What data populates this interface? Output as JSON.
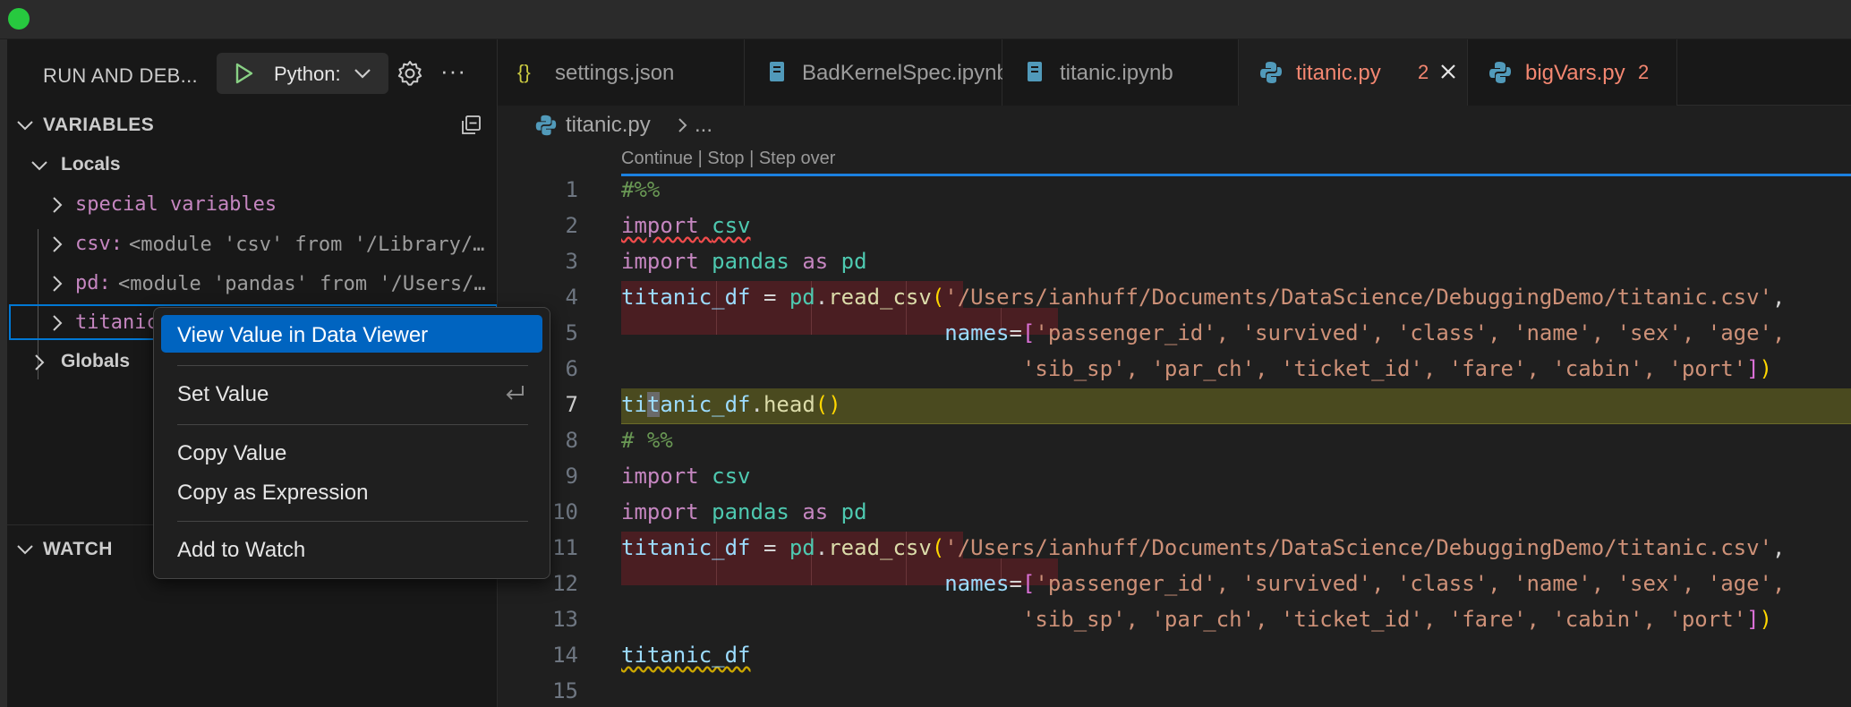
{
  "debug_toolbar": {
    "title": "RUN AND DEB...",
    "launch_config": "Python:"
  },
  "variables": {
    "header": "VARIABLES",
    "locals_label": "Locals",
    "items": [
      {
        "name": "special variables",
        "value": ""
      },
      {
        "name": "csv:",
        "value": "<module 'csv' from '/Library/…"
      },
      {
        "name": "pd:",
        "value": "<module 'pandas' from '/Users/…"
      },
      {
        "name": "titanic",
        "value": ""
      }
    ],
    "globals_label": "Globals"
  },
  "watch": {
    "header": "WATCH"
  },
  "tabs": [
    {
      "label": "settings.json",
      "icon": "json-icon",
      "badge": "",
      "active": false
    },
    {
      "label": "BadKernelSpec.ipynb",
      "icon": "notebook-icon",
      "badge": "",
      "active": false
    },
    {
      "label": "titanic.ipynb",
      "icon": "notebook-icon",
      "badge": "",
      "active": false
    },
    {
      "label": "titanic.py",
      "icon": "python-icon",
      "badge": "2",
      "active": true
    },
    {
      "label": "bigVars.py",
      "icon": "python-icon",
      "badge": "2",
      "active": false
    }
  ],
  "breadcrumb": {
    "file": "titanic.py",
    "more": "..."
  },
  "editor": {
    "codelens": "Continue | Stop | Step over",
    "line_numbers": [
      "1",
      "2",
      "3",
      "4",
      "5",
      "6",
      "7",
      "8",
      "9",
      "10",
      "11",
      "12",
      "13",
      "14",
      "15"
    ],
    "current_line": 7,
    "lines": {
      "l1": "#%%",
      "import_kw": "import",
      "csv_mod": "csv",
      "pandas_mod": "pandas",
      "as_kw": "as",
      "pd_alias": "pd",
      "df_var": "titanic_df",
      "eq": " = ",
      "read_csv": "read_csv",
      "path": "'/Users/ianhuff/Documents/DataScience/DebuggingDemo/titanic.csv'",
      "names_kw": "names",
      "names_row1": "'passenger_id', 'survived', 'class', 'name', 'sex', 'age',",
      "names_row2": "'sib_sp', 'par_ch', 'ticket_id', 'fare', 'cabin', 'port'",
      "head": "head",
      "cell_marker": "# %%",
      "cursor_before": "ti",
      "cursor_char": "t",
      "cursor_after": "anic_df"
    }
  },
  "context_menu": {
    "items": [
      {
        "label": "View Value in Data Viewer"
      },
      {
        "label": "Set Value"
      },
      {
        "label": "Copy Value"
      },
      {
        "label": "Copy as Expression"
      },
      {
        "label": "Add to Watch"
      }
    ]
  }
}
